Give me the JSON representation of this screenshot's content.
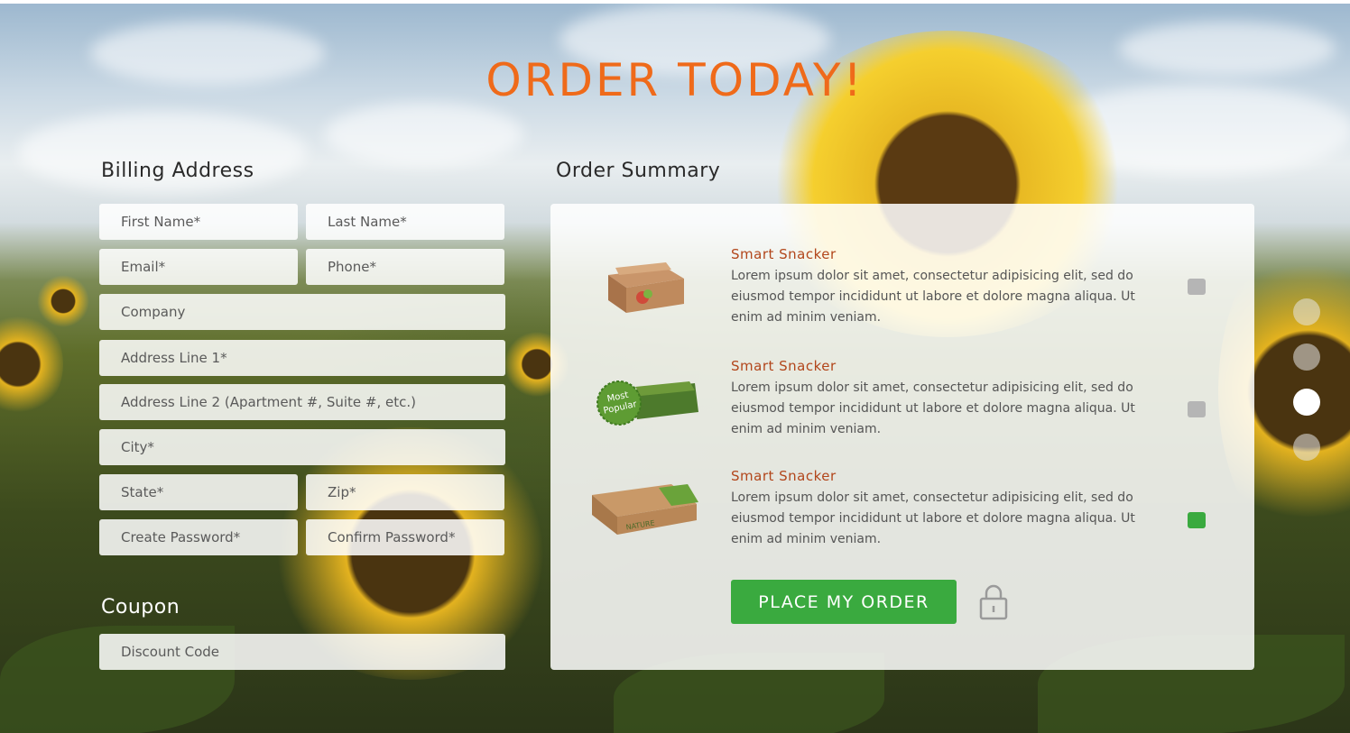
{
  "page": {
    "title": "ORDER TODAY!",
    "accent_color": "#ef6a1a",
    "background": "sunflower-field-photo"
  },
  "billing": {
    "heading": "Billing Address",
    "fields": {
      "first_name": "First Name*",
      "last_name": "Last Name*",
      "email": "Email*",
      "phone": "Phone*",
      "company": "Company",
      "address1": "Address Line 1*",
      "address2": "Address Line 2 (Apartment #, Suite #, etc.)",
      "city": "City*",
      "state": "State*",
      "zip": "Zip*",
      "create_password": "Create Password*",
      "confirm_password": "Confirm Password*"
    }
  },
  "coupon": {
    "heading": "Coupon",
    "placeholder": "Discount Code"
  },
  "summary": {
    "heading": "Order Summary",
    "products": [
      {
        "name": "Smart Snacker",
        "description": "Lorem ipsum dolor sit amet, consectetur adipisicing elit, sed do eiusmod tempor incididunt ut labore et dolore magna aliqua. Ut enim ad minim veniam.",
        "image": "snack-box-open",
        "selected": false
      },
      {
        "name": "Smart Snacker",
        "description": "Lorem ipsum dolor sit amet, consectetur adipisicing elit, sed do eiusmod tempor incididunt ut labore et dolore magna aliqua. Ut enim ad minim veniam.",
        "image": "snack-box-most-popular",
        "badge": "Most Popular",
        "selected": false
      },
      {
        "name": "Smart Snacker",
        "description": "Lorem ipsum dolor sit amet, consectetur adipisicing elit, sed do eiusmod tempor incididunt ut labore et dolore magna aliqua. Ut enim ad minim veniam.",
        "image": "snack-box-nature",
        "box_text": "NATURE",
        "selected": true
      }
    ],
    "order_button": "PLACE MY ORDER",
    "button_color": "#3aaa3f",
    "unchecked_color": "#b5b5b5",
    "lock_icon": "lock-icon"
  },
  "slider_dots": {
    "count": 4,
    "active_index": 2
  }
}
